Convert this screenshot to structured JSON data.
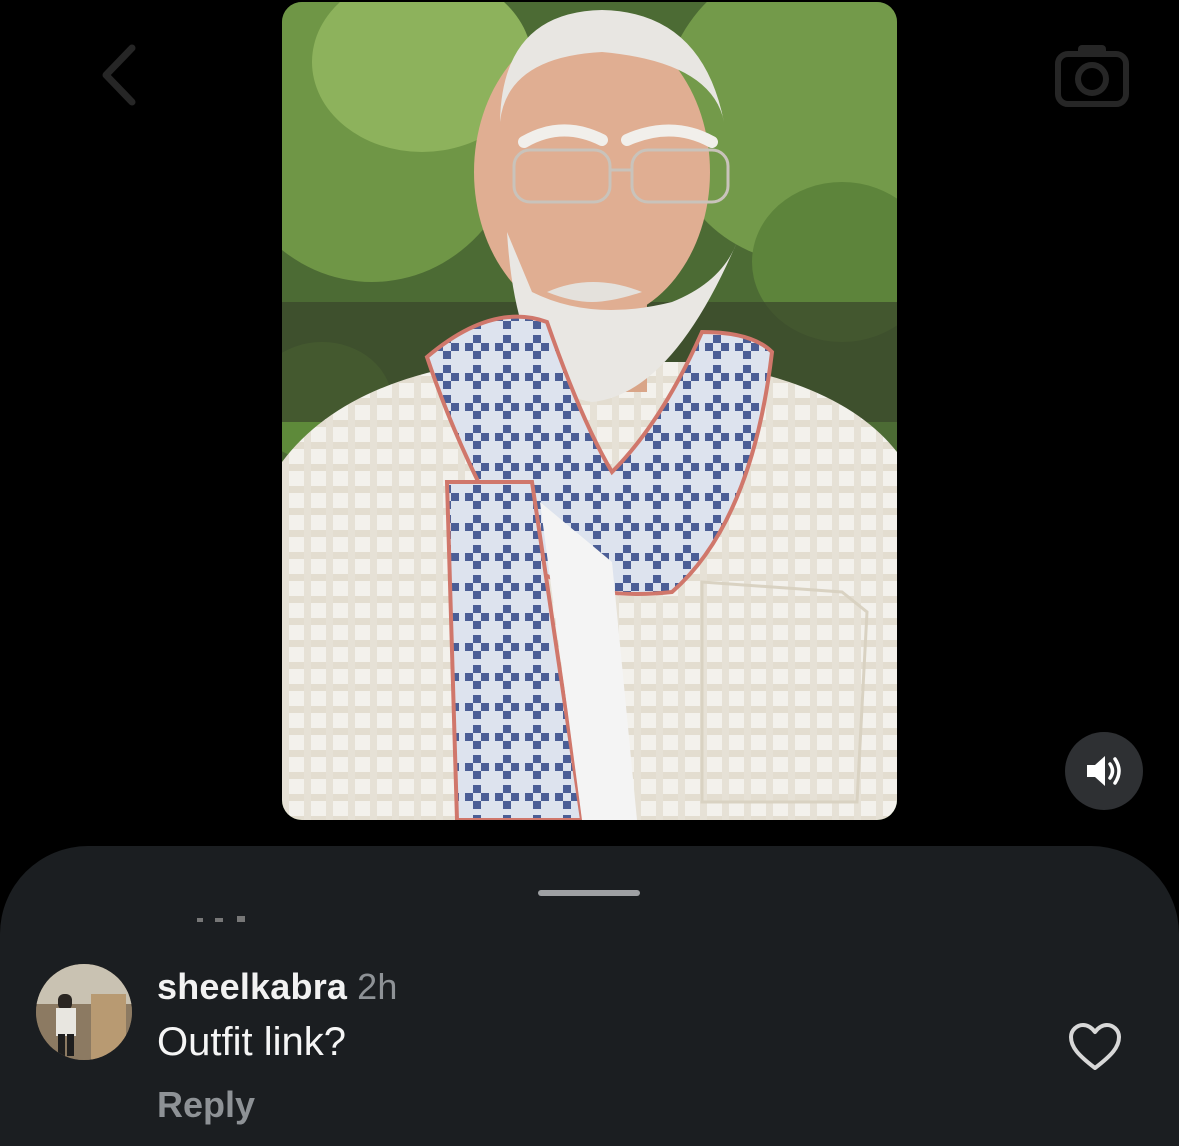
{
  "header": {
    "back_icon": "chevron-left-icon",
    "camera_icon": "camera-icon"
  },
  "video": {
    "mute_icon": "speaker-on-icon"
  },
  "comments_sheet": {
    "comment": {
      "username": "sheelkabra",
      "timestamp": "2h",
      "text": "Outfit link?",
      "reply_label": "Reply",
      "like_icon": "heart-outline-icon"
    }
  },
  "colors": {
    "background": "#000000",
    "sheet": "#1b1e21",
    "muted_text": "#8e9296",
    "primary_text": "#f5f5f5"
  }
}
